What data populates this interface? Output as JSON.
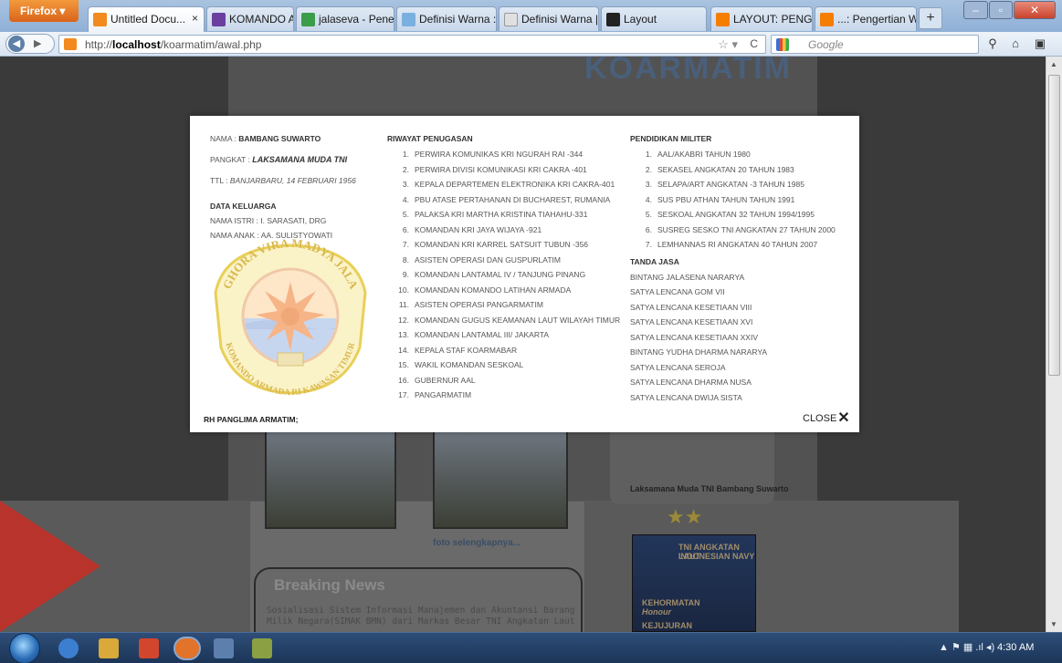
{
  "browser": {
    "menu_button": "Firefox",
    "tabs": [
      {
        "label": "Untitled Docu...",
        "icon": "site-icon",
        "color": "#f28a1e",
        "active": true
      },
      {
        "label": "KOMANDO ARM...",
        "icon": "site-icon",
        "color": "#6b3fa0",
        "active": false
      },
      {
        "label": "jalaseva - Penelu...",
        "icon": "site-icon",
        "color": "#3b9c4b",
        "active": false
      },
      {
        "label": "Definisi Warna : ...",
        "icon": "site-icon",
        "color": "#7ab0e0",
        "active": false
      },
      {
        "label": "Definisi Warna | ...",
        "icon": "site-icon",
        "color": "#e0e0e0",
        "active": false
      },
      {
        "label": "Layout",
        "icon": "site-icon",
        "color": "#222222",
        "active": false
      },
      {
        "label": "LAYOUT: PENGE...",
        "icon": "blogger-icon",
        "color": "#f57d00",
        "active": false
      },
      {
        "label": "...: Pengertian W...",
        "icon": "blogger-icon",
        "color": "#f57d00",
        "active": false
      }
    ],
    "url_prefix": "http://",
    "url_host": "localhost",
    "url_path": "/koarmatim/awal.php",
    "search_placeholder": "Google"
  },
  "page": {
    "banner_title": "KOARMATIM",
    "photo_caption": "Laksamana Muda TNI Bambang Suwarto",
    "more_link": "foto selengkapnya...",
    "news_title": "Breaking News",
    "news_text": "Sosialisasi Sistem Informasi Manajemen dan Akuntansi Barang Milik Negara(SIMAK BMN) dari Markas Besar TNI Angkatan Laut",
    "poster_lines": [
      "TNI ANGKATAN LAUT",
      "INDONESIAN NAVY",
      "KEHORMATAN",
      "Honour",
      "KEJUJURAN"
    ]
  },
  "modal": {
    "nama_label": "NAMA : ",
    "nama": "BAMBANG SUWARTO",
    "pangkat_label": "PANGKAT : ",
    "pangkat": "LAKSAMANA MUDA TNI",
    "ttl_label": "TTL : ",
    "ttl": "BANJARBARU, 14 FEBRUARI 1956",
    "keluarga_heading": "DATA KELUARGA",
    "istri": "NAMA ISTRI : I. SARASATI, DRG",
    "anak": "NAMA ANAK : AA. SULISTYOWATI",
    "emblem_text_top": "GHORA VIRA MADYA JALA",
    "emblem_text_bottom": "KOMANDO ARMADA RI KAWASAN TIMUR",
    "riwayat_heading": "RIWAYAT PENUGASAN",
    "riwayat": [
      {
        "n": "1.",
        "t": "PERWIRA KOMUNIKAS KRI NGURAH RAI -344"
      },
      {
        "n": "2.",
        "t": "PERWIRA DIVISI KOMUNIKASI KRI CAKRA -401"
      },
      {
        "n": "3.",
        "t": "KEPALA DEPARTEMEN ELEKTRONIKA KRI CAKRA-401"
      },
      {
        "n": "4.",
        "t": "PBU ATASE PERTAHANAN DI BUCHAREST, RUMANIA"
      },
      {
        "n": "5.",
        "t": "PALAKSA KRI MARTHA KRISTINA TIAHAHU-331"
      },
      {
        "n": "6.",
        "t": "KOMANDAN KRI JAYA WIJAYA -921"
      },
      {
        "n": "7.",
        "t": "KOMANDAN KRI KARREL SATSUIT TUBUN -356"
      },
      {
        "n": "8.",
        "t": "ASISTEN OPERASI DAN GUSPURLATIM"
      },
      {
        "n": "9.",
        "t": "KOMANDAN LANTAMAL IV / TANJUNG PINANG"
      },
      {
        "n": "10.",
        "t": "KOMANDAN KOMANDO LATIHAN ARMADA"
      },
      {
        "n": "11.",
        "t": "ASISTEN OPERASI PANGARMATIM"
      },
      {
        "n": "12.",
        "t": "KOMANDAN GUGUS KEAMANAN LAUT WILAYAH TIMUR"
      },
      {
        "n": "13.",
        "t": "KOMANDAN LANTAMAL III/ JAKARTA"
      },
      {
        "n": "14.",
        "t": "KEPALA STAF KOARMABAR"
      },
      {
        "n": "15.",
        "t": "WAKIL KOMANDAN SESKOAL"
      },
      {
        "n": "16.",
        "t": "GUBERNUR AAL"
      },
      {
        "n": "17.",
        "t": "PANGARMATIM"
      }
    ],
    "pendidikan_heading": "PENDIDIKAN MILITER",
    "pendidikan": [
      {
        "n": "1.",
        "t": "AAL/AKABRI TAHUN 1980"
      },
      {
        "n": "2.",
        "t": "SEKASEL ANGKATAN 20 TAHUN 1983"
      },
      {
        "n": "3.",
        "t": "SELAPA/ART ANGKATAN -3 TAHUN 1985"
      },
      {
        "n": "4.",
        "t": "SUS PBU ATHAN TAHUN TAHUN 1991"
      },
      {
        "n": "5.",
        "t": "SESKOAL ANGKATAN 32 TAHUN 1994/1995"
      },
      {
        "n": "6.",
        "t": "SUSREG SESKO TNI ANGKATAN 27 TAHUN 2000"
      },
      {
        "n": "7.",
        "t": "LEMHANNAS RI ANGKATAN 40 TAHUN 2007"
      }
    ],
    "tanda_jasa_heading": "TANDA JASA",
    "tanda_jasa": [
      "BINTANG JALASENA NARARYA",
      "SATYA LENCANA GOM VII",
      "SATYA LENCANA KESETIAAN VIII",
      "SATYA LENCANA KESETIAAN XVI",
      "SATYA LENCANA KESETIAAN XXIV",
      "BINTANG YUDHA DHARMA NARARYA",
      "SATYA LENCANA SEROJA",
      "SATYA LENCANA DHARMA NUSA",
      "SATYA LENCANA DWIJA SISTA"
    ],
    "footer_left": "RH PANGLIMA ARMATIM;",
    "close_label": "CLOSE",
    "close_glyph": "✕"
  },
  "taskbar": {
    "clock": "4:30 AM"
  }
}
